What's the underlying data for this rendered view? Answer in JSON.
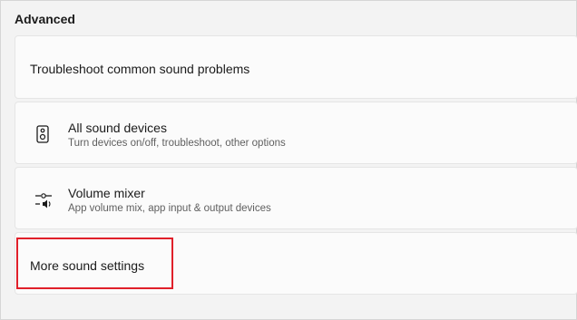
{
  "section": {
    "title": "Advanced"
  },
  "items": [
    {
      "title": "Troubleshoot common sound problems",
      "subtitle": "",
      "icon": ""
    },
    {
      "title": "All sound devices",
      "subtitle": "Turn devices on/off, troubleshoot, other options",
      "icon": "speaker-icon"
    },
    {
      "title": "Volume mixer",
      "subtitle": "App volume mix, app input & output devices",
      "icon": "volume-mixer-icon"
    },
    {
      "title": "More sound settings",
      "subtitle": "",
      "icon": ""
    }
  ],
  "colors": {
    "highlight_border": "#e0202a",
    "background": "#f3f3f3",
    "card": "#fbfbfb"
  }
}
